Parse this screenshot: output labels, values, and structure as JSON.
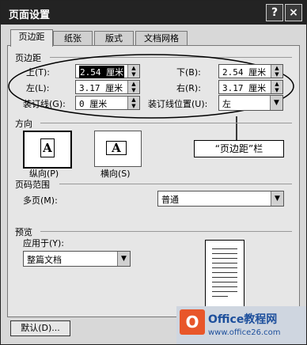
{
  "window": {
    "title": "页面设置",
    "help_glyph": "?",
    "close_glyph": "×"
  },
  "tabs": [
    {
      "label": "页边距"
    },
    {
      "label": "纸张"
    },
    {
      "label": "版式"
    },
    {
      "label": "文档网格"
    }
  ],
  "margins": {
    "section_title": "页边距",
    "top": {
      "label": "上(T):",
      "value": "2.54 厘米"
    },
    "bottom": {
      "label": "下(B):",
      "value": "2.54 厘米"
    },
    "left": {
      "label": "左(L):",
      "value": "3.17 厘米"
    },
    "right": {
      "label": "右(R):",
      "value": "3.17 厘米"
    },
    "gutter": {
      "label": "装订线(G):",
      "value": "0 厘米"
    },
    "gutter_position": {
      "label": "装订线位置(U):",
      "value": "左"
    }
  },
  "orientation": {
    "section_title": "方向",
    "glyph": "A",
    "portrait": "纵向(P)",
    "landscape": "横向(S)"
  },
  "pages": {
    "section_title": "页码范围",
    "multiple_label": "多页(M):",
    "multiple_value": "普通"
  },
  "preview": {
    "section_title": "预览",
    "apply_to_label": "应用于(Y):",
    "apply_to_value": "整篇文档"
  },
  "callout": "“页边距”栏",
  "buttons": {
    "default": "默认(D)..."
  },
  "watermark": {
    "text": "Office教程网",
    "url": "www.office26.com"
  },
  "icons": {
    "spin": "spin-arrows-icon",
    "dropdown": "chevron-down-icon"
  }
}
